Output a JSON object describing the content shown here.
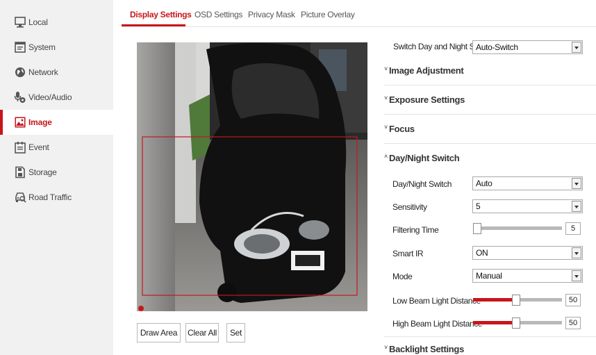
{
  "sidebar": {
    "items": [
      {
        "label": "Local",
        "icon": "monitor-icon",
        "active": false
      },
      {
        "label": "System",
        "icon": "system-icon",
        "active": false
      },
      {
        "label": "Network",
        "icon": "globe-icon",
        "active": false
      },
      {
        "label": "Video/Audio",
        "icon": "video-audio-icon",
        "active": false
      },
      {
        "label": "Image",
        "icon": "image-icon",
        "active": true
      },
      {
        "label": "Event",
        "icon": "calendar-icon",
        "active": false
      },
      {
        "label": "Storage",
        "icon": "storage-icon",
        "active": false
      },
      {
        "label": "Road Traffic",
        "icon": "road-traffic-icon",
        "active": false
      }
    ]
  },
  "tabs": [
    {
      "label": "Display Settings",
      "active": true
    },
    {
      "label": "OSD Settings",
      "active": false
    },
    {
      "label": "Privacy Mask",
      "active": false
    },
    {
      "label": "Picture Overlay",
      "active": false
    }
  ],
  "buttons": {
    "draw_area": "Draw Area",
    "clear_all": "Clear All",
    "set": "Set"
  },
  "settings": {
    "switch_day_night": {
      "label": "Switch Day and Night Set...",
      "value": "Auto-Switch"
    },
    "sections": {
      "image_adjustment": "Image Adjustment",
      "exposure_settings": "Exposure Settings",
      "focus": "Focus",
      "day_night_switch": "Day/Night Switch",
      "backlight_settings": "Backlight Settings"
    },
    "day_night": {
      "switch_label": "Day/Night Switch",
      "switch_value": "Auto",
      "sensitivity_label": "Sensitivity",
      "sensitivity_value": "5",
      "filtering_time_label": "Filtering Time",
      "filtering_time_value": "5",
      "smart_ir_label": "Smart IR",
      "smart_ir_value": "ON",
      "mode_label": "Mode",
      "mode_value": "Manual",
      "low_beam_label": "Low Beam Light Distance",
      "low_beam_value": "50",
      "high_beam_label": "High Beam Light Distance",
      "high_beam_value": "50"
    }
  },
  "colors": {
    "accent": "#c7161c",
    "sidebar_bg": "#f1f1f1"
  }
}
